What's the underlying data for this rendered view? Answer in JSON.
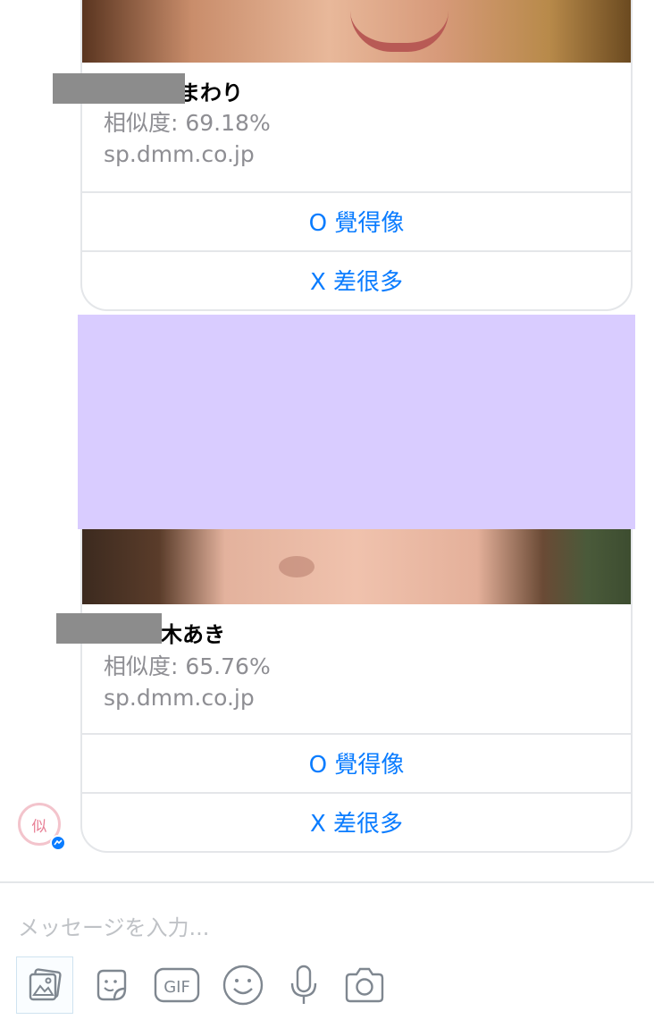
{
  "messages": [
    {
      "title": "まわり",
      "similarity": "相似度: 69.18%",
      "source": "sp.dmm.co.jp",
      "buttons": [
        "O 覺得像",
        "X 差很多"
      ]
    },
    {
      "title": "木あき",
      "similarity": "相似度: 65.76%",
      "source": "sp.dmm.co.jp",
      "buttons": [
        "O 覺得像",
        "X 差很多"
      ]
    }
  ],
  "avatar": {
    "glyph": "似"
  },
  "composer": {
    "placeholder": "メッセージを入力...",
    "tools": [
      "photo-icon",
      "sticker-icon",
      "gif-icon",
      "emoji-icon",
      "microphone-icon",
      "camera-icon"
    ],
    "gif_label": "GIF"
  },
  "colors": {
    "link": "#0a7cff",
    "redaction_block": "#d9ccff",
    "redaction_bar": "#8c8c8c"
  }
}
